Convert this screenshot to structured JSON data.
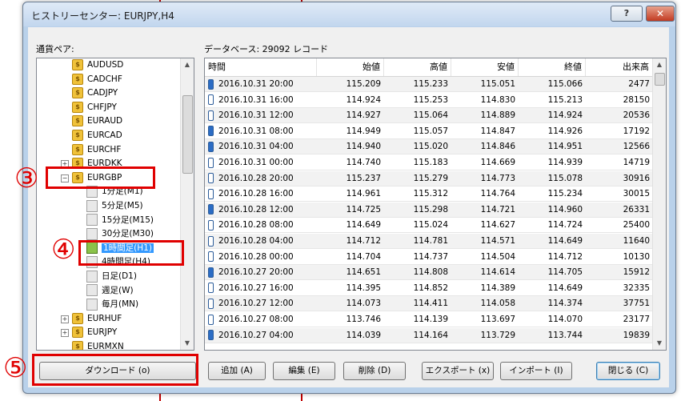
{
  "window": {
    "title": "ヒストリーセンター: EURJPY,H4",
    "help_label": "?",
    "close_label": "✕"
  },
  "tree": {
    "label": "通貨ペア:",
    "items": [
      {
        "text": "AUDUSD",
        "kind": "symbol"
      },
      {
        "text": "CADCHF",
        "kind": "symbol"
      },
      {
        "text": "CADJPY",
        "kind": "symbol"
      },
      {
        "text": "CHFJPY",
        "kind": "symbol"
      },
      {
        "text": "EURAUD",
        "kind": "symbol"
      },
      {
        "text": "EURCAD",
        "kind": "symbol"
      },
      {
        "text": "EURCHF",
        "kind": "symbol"
      },
      {
        "text": "EURDKK",
        "kind": "symbol"
      },
      {
        "text": "EURGBP",
        "kind": "symbol"
      },
      {
        "text": "1分足(M1)",
        "kind": "tf"
      },
      {
        "text": "5分足(M5)",
        "kind": "tf"
      },
      {
        "text": "15分足(M15)",
        "kind": "tf"
      },
      {
        "text": "30分足(M30)",
        "kind": "tf"
      },
      {
        "text": "1時間足(H1)",
        "kind": "tf"
      },
      {
        "text": "4時間足(H4)",
        "kind": "tf"
      },
      {
        "text": "日足(D1)",
        "kind": "tf"
      },
      {
        "text": "週足(W)",
        "kind": "tf"
      },
      {
        "text": "毎月(MN)",
        "kind": "tf"
      },
      {
        "text": "EURHUF",
        "kind": "symbol"
      },
      {
        "text": "EURJPY",
        "kind": "symbol"
      },
      {
        "text": "EURMXN",
        "kind": "symbol"
      }
    ]
  },
  "grid": {
    "label": "データベース: 29092 レコード",
    "columns": [
      "時間",
      "始値",
      "高値",
      "安値",
      "終値",
      "出来高"
    ],
    "rows": [
      [
        "2016.10.31 20:00",
        "115.209",
        "115.233",
        "115.051",
        "115.066",
        "2477"
      ],
      [
        "2016.10.31 16:00",
        "114.924",
        "115.253",
        "114.830",
        "115.213",
        "28150"
      ],
      [
        "2016.10.31 12:00",
        "114.927",
        "115.064",
        "114.889",
        "114.924",
        "20536"
      ],
      [
        "2016.10.31 08:00",
        "114.949",
        "115.057",
        "114.847",
        "114.926",
        "17192"
      ],
      [
        "2016.10.31 04:00",
        "114.940",
        "115.020",
        "114.846",
        "114.951",
        "12566"
      ],
      [
        "2016.10.31 00:00",
        "114.740",
        "115.183",
        "114.669",
        "114.939",
        "14719"
      ],
      [
        "2016.10.28 20:00",
        "115.237",
        "115.279",
        "114.773",
        "115.078",
        "30916"
      ],
      [
        "2016.10.28 16:00",
        "114.961",
        "115.312",
        "114.764",
        "115.234",
        "30015"
      ],
      [
        "2016.10.28 12:00",
        "114.725",
        "115.298",
        "114.721",
        "114.960",
        "26331"
      ],
      [
        "2016.10.28 08:00",
        "114.649",
        "115.024",
        "114.627",
        "114.724",
        "25400"
      ],
      [
        "2016.10.28 04:00",
        "114.712",
        "114.781",
        "114.571",
        "114.649",
        "11640"
      ],
      [
        "2016.10.28 00:00",
        "114.704",
        "114.737",
        "114.504",
        "114.712",
        "10130"
      ],
      [
        "2016.10.27 20:00",
        "114.651",
        "114.808",
        "114.614",
        "114.705",
        "15912"
      ],
      [
        "2016.10.27 16:00",
        "114.395",
        "114.852",
        "114.389",
        "114.649",
        "32335"
      ],
      [
        "2016.10.27 12:00",
        "114.073",
        "114.411",
        "114.058",
        "114.374",
        "37751"
      ],
      [
        "2016.10.27 08:00",
        "113.746",
        "114.139",
        "113.697",
        "114.070",
        "23177"
      ],
      [
        "2016.10.27 04:00",
        "114.039",
        "114.164",
        "113.729",
        "113.744",
        "19839"
      ]
    ]
  },
  "buttons": {
    "download": "ダウンロード (o)",
    "add": "追加 (A)",
    "edit": "編集 (E)",
    "delete": "削除 (D)",
    "export": "エクスポート (x)",
    "import": "インポート (I)",
    "close": "閉じる (C)"
  },
  "annotations": {
    "n3": "③",
    "n4": "④",
    "n5": "⑤"
  },
  "colors": {
    "annotation": "#e00000",
    "selection": "#3399ff",
    "title_bar": "#c2d6ee"
  }
}
